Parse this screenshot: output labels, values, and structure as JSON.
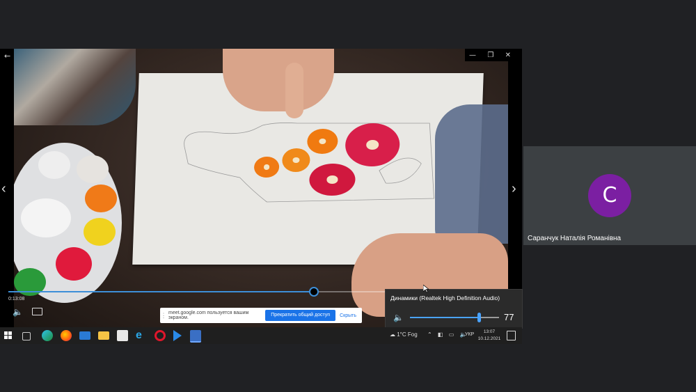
{
  "player": {
    "time": "0:13:08",
    "progress_fraction": 0.63
  },
  "share_bar": {
    "message": "meet.google.com пользуется вашим экраном.",
    "stop_label": "Прекратить общий доступ",
    "hide_label": "Скрыть"
  },
  "volume": {
    "device": "Динамики (Realtek High Definition Audio)",
    "level": "77",
    "fraction": 0.77
  },
  "tray": {
    "weather": "1°C  Fog",
    "lang": "УКР",
    "time": "13:07",
    "date": "10.12.2021"
  },
  "participant": {
    "initial": "С",
    "name": "Саранчук Наталія Романівна",
    "avatar_color": "#7b1fa2"
  },
  "taskbar_icons": [
    "task-view-icon",
    "edge-icon",
    "firefox-icon",
    "mail-icon",
    "file-explorer-icon",
    "store-icon",
    "ie-icon",
    "opera-icon",
    "media-player-icon",
    "screen-share-icon"
  ],
  "colors": {
    "accent": "#3d8fd8",
    "tile_bg": "#3c4043",
    "stop_button": "#1a73e8"
  }
}
